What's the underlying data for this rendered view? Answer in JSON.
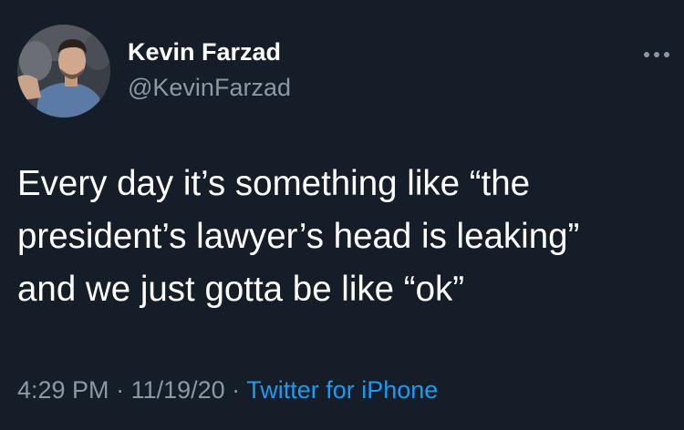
{
  "author": {
    "display_name": "Kevin Farzad",
    "handle": "@KevinFarzad",
    "avatar_icon": "profile-photo"
  },
  "tweet": {
    "text": "Every day it’s something like “the\npresident’s lawyer’s head is leaking”\nand we just gotta be like “ok”",
    "time": "4:29 PM",
    "separator": " · ",
    "date": "11/19/20",
    "source": "Twitter for iPhone"
  },
  "colors": {
    "background": "#151d28",
    "primary_text": "#ffffff",
    "secondary_text": "#8b98a5",
    "link": "#1d9bf0"
  }
}
